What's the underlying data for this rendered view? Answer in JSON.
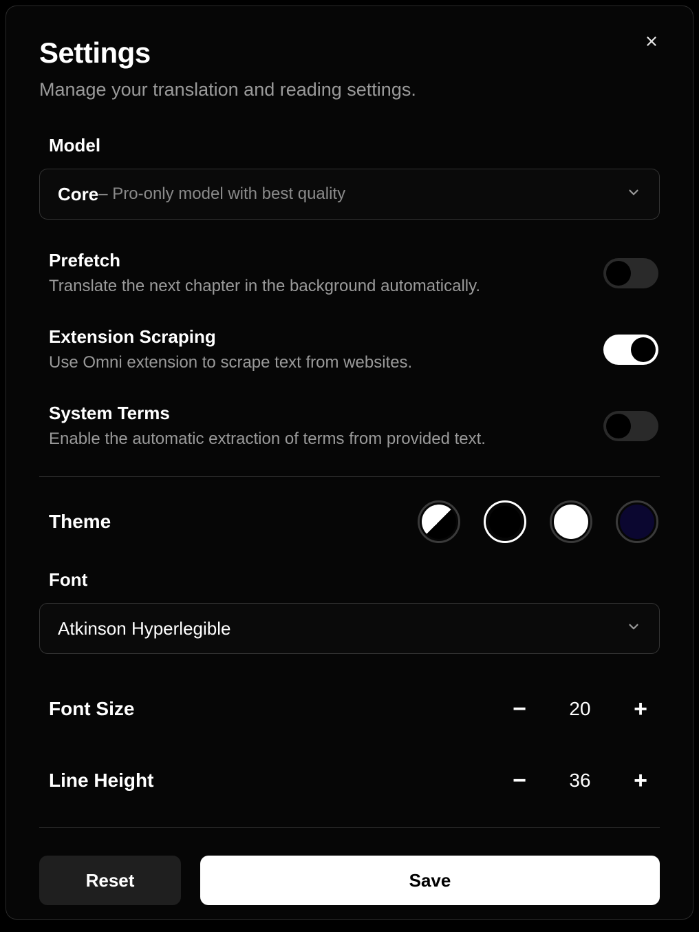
{
  "dialog": {
    "title": "Settings",
    "subtitle": "Manage your translation and reading settings."
  },
  "model": {
    "label": "Model",
    "selected_name": "Core",
    "selected_desc": " – Pro-only model with best quality"
  },
  "toggles": {
    "prefetch": {
      "title": "Prefetch",
      "desc": "Translate the next chapter in the background automatically.",
      "on": false
    },
    "extension": {
      "title": "Extension Scraping",
      "desc": "Use Omni extension to scrape text from websites.",
      "on": true
    },
    "system_terms": {
      "title": "System Terms",
      "desc": "Enable the automatic extraction of terms from provided text.",
      "on": false
    }
  },
  "theme": {
    "label": "Theme",
    "options": [
      "system",
      "dark",
      "light",
      "navy"
    ],
    "selected": "dark"
  },
  "font": {
    "label": "Font",
    "selected": "Atkinson Hyperlegible"
  },
  "font_size": {
    "label": "Font Size",
    "value": "20"
  },
  "line_height": {
    "label": "Line Height",
    "value": "36"
  },
  "footer": {
    "reset": "Reset",
    "save": "Save"
  }
}
